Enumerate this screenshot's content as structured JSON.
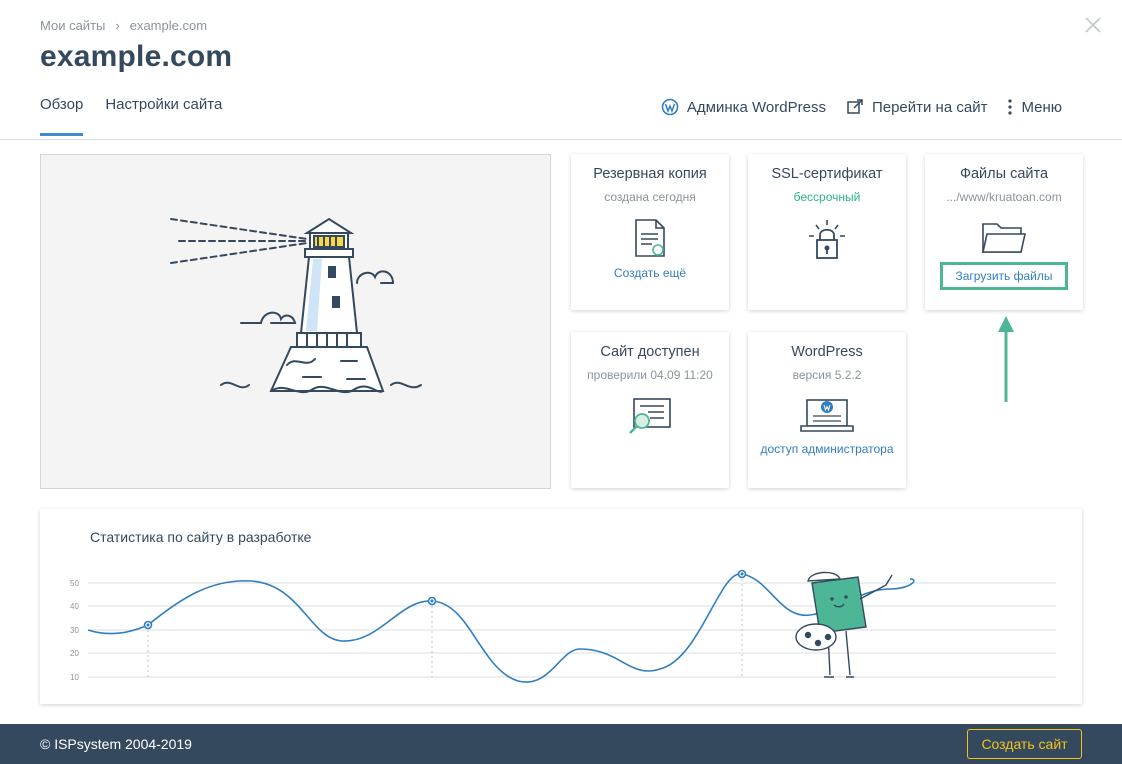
{
  "breadcrumb": {
    "root": "Мои сайты",
    "separator": "›",
    "current": "example.com"
  },
  "page_title": "example.com",
  "tabs": [
    {
      "label": "Обзор",
      "active": true
    },
    {
      "label": "Настройки сайта",
      "active": false
    }
  ],
  "actions": {
    "wp_admin": "Админка WordPress",
    "goto_site": "Перейти на сайт",
    "menu": "Меню"
  },
  "cards": {
    "backup": {
      "title": "Резервная копия",
      "subtitle": "создана сегодня",
      "link": "Создать ещё"
    },
    "ssl": {
      "title": "SSL-сертификат",
      "subtitle": "бессрочный"
    },
    "files": {
      "title": "Файлы сайта",
      "subtitle": ".../www/kruatoan.com",
      "button": "Загрузить файлы"
    },
    "available": {
      "title": "Сайт доступен",
      "subtitle": "проверили 04.09 11:20"
    },
    "wordpress": {
      "title": "WordPress",
      "subtitle": "версия 5.2.2",
      "link": "доступ администратора"
    }
  },
  "stats": {
    "title": "Статистика по сайту в разработке",
    "y_ticks": [
      "50",
      "40",
      "30",
      "20",
      "10"
    ]
  },
  "footer": {
    "copyright": "© ISPsystem 2004-2019",
    "create_button": "Создать сайт"
  },
  "colors": {
    "accent": "#3d8bd3",
    "highlight": "#4db696",
    "footer": "#34495e",
    "cta": "#f0c419"
  },
  "icons": [
    "close-icon",
    "wordpress-icon",
    "external-link-icon",
    "kebab-menu-icon",
    "document-icon",
    "lock-icon",
    "folder-icon",
    "search-certificate-icon",
    "laptop-wordpress-icon",
    "lighthouse-illustration",
    "arrow-up-icon"
  ]
}
